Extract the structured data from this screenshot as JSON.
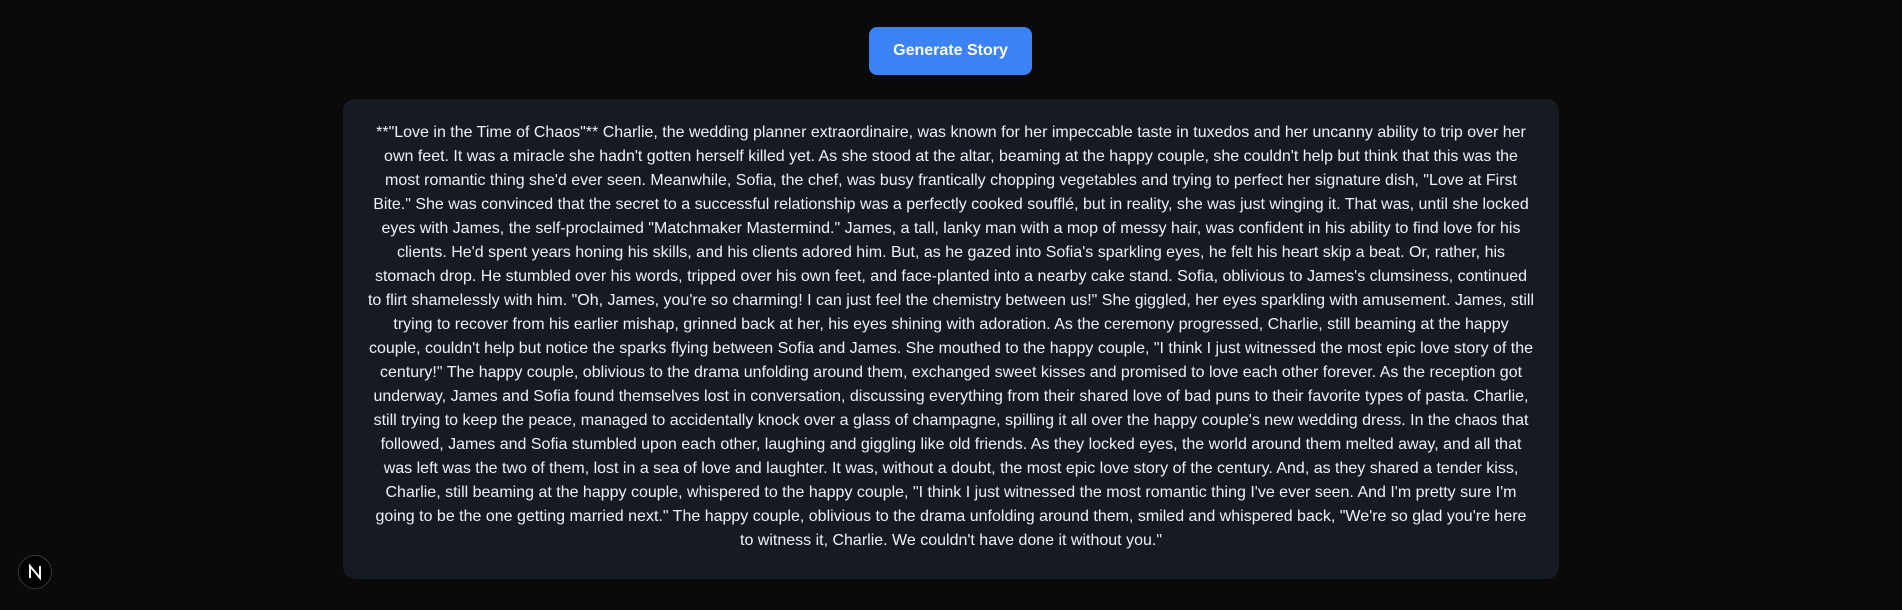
{
  "toolbar": {
    "generate_label": "Generate Story",
    "accent_color": "#3b82f6"
  },
  "story": {
    "text": "**\"Love in the Time of Chaos\"** Charlie, the wedding planner extraordinaire, was known for her impeccable taste in tuxedos and her uncanny ability to trip over her own feet. It was a miracle she hadn't gotten herself killed yet. As she stood at the altar, beaming at the happy couple, she couldn't help but think that this was the most romantic thing she'd ever seen. Meanwhile, Sofia, the chef, was busy frantically chopping vegetables and trying to perfect her signature dish, \"Love at First Bite.\" She was convinced that the secret to a successful relationship was a perfectly cooked soufflé, but in reality, she was just winging it. That was, until she locked eyes with James, the self-proclaimed \"Matchmaker Mastermind.\" James, a tall, lanky man with a mop of messy hair, was confident in his ability to find love for his clients. He'd spent years honing his skills, and his clients adored him. But, as he gazed into Sofia's sparkling eyes, he felt his heart skip a beat. Or, rather, his stomach drop. He stumbled over his words, tripped over his own feet, and face-planted into a nearby cake stand. Sofia, oblivious to James's clumsiness, continued to flirt shamelessly with him. \"Oh, James, you're so charming! I can just feel the chemistry between us!\" She giggled, her eyes sparkling with amusement. James, still trying to recover from his earlier mishap, grinned back at her, his eyes shining with adoration. As the ceremony progressed, Charlie, still beaming at the happy couple, couldn't help but notice the sparks flying between Sofia and James. She mouthed to the happy couple, \"I think I just witnessed the most epic love story of the century!\" The happy couple, oblivious to the drama unfolding around them, exchanged sweet kisses and promised to love each other forever. As the reception got underway, James and Sofia found themselves lost in conversation, discussing everything from their shared love of bad puns to their favorite types of pasta. Charlie, still trying to keep the peace, managed to accidentally knock over a glass of champagne, spilling it all over the happy couple's new wedding dress. In the chaos that followed, James and Sofia stumbled upon each other, laughing and giggling like old friends. As they locked eyes, the world around them melted away, and all that was left was the two of them, lost in a sea of love and laughter. It was, without a doubt, the most epic love story of the century. And, as they shared a tender kiss, Charlie, still beaming at the happy couple, whispered to the happy couple, \"I think I just witnessed the most romantic thing I've ever seen. And I'm pretty sure I'm going to be the one getting married next.\" The happy couple, oblivious to the drama unfolding around them, smiled and whispered back, \"We're so glad you're here to witness it, Charlie. We couldn't have done it without you.\""
  },
  "dev_badge": {
    "icon": "n-logo-icon"
  }
}
